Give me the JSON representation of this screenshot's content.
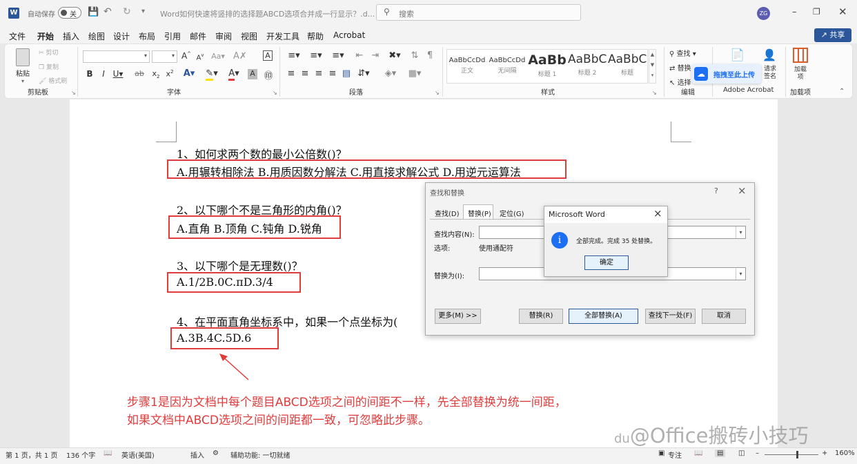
{
  "titlebar": {
    "autosave_label": "自动保存",
    "autosave_state": "关",
    "doc_title": "Word如何快速将竖排的选择题ABCD选项合并成一行显示？.d...",
    "search_placeholder": "搜索",
    "user_initials": "ZG",
    "share_label": "共享"
  },
  "menu": [
    "文件",
    "开始",
    "插入",
    "绘图",
    "设计",
    "布局",
    "引用",
    "邮件",
    "审阅",
    "视图",
    "开发工具",
    "帮助",
    "Acrobat"
  ],
  "ribbon": {
    "clipboard": {
      "paste": "粘贴",
      "cut": "剪切",
      "copy": "复制",
      "format_painter": "格式刷",
      "group": "剪贴板"
    },
    "font_group": "字体",
    "paragraph_group": "段落",
    "styles": [
      {
        "preview": "AaBbCcDd",
        "name": "正文"
      },
      {
        "preview": "AaBbCcDd",
        "name": "无间隔"
      },
      {
        "preview": "AaBb",
        "name": "标题 1"
      },
      {
        "preview": "AaBbC",
        "name": "标题 2"
      },
      {
        "preview": "AaBbC",
        "name": "标题"
      }
    ],
    "styles_group": "样式",
    "find": "查找",
    "replace": "替换",
    "select": "选择",
    "editing_group": "编辑",
    "upload_label": "拖拽至此上传",
    "request_sign": "请求签名",
    "acrobat_group": "Adobe Acrobat",
    "addins": "加载项",
    "addins_btn": "加载项"
  },
  "document": {
    "q1": "1、如何求两个数的最小公倍数()？",
    "a1": "A.用辗转相除法 B.用质因数分解法 C.用直接求解公式 D.用逆元运算法",
    "q2": "2、以下哪个不是三角形的内角()？",
    "a2": "A.直角 B.顶角 C.钝角 D.锐角",
    "q3": "3、以下哪个是无理数()？",
    "a3": "A.1/2B.0C.πD.3/4",
    "q4": "4、在平面直角坐标系中，如果一个点坐标为(",
    "a4": "A.3B.4C.5D.6",
    "note_line1": "步骤1是因为文档中每个题目ABCD选项之间的间距不一样，先全部替换为统一间距，",
    "note_line2": "如果文档中ABCD选项之间的间距都一致，可忽略此步骤。",
    "watermark": "@Office搬砖小技巧"
  },
  "find_replace": {
    "title": "查找和替换",
    "help": "?",
    "close": "×",
    "tabs": [
      "查找(D)",
      "替换(P)",
      "定位(G)"
    ],
    "find_label": "查找内容(N):",
    "options_label": "选项:",
    "options_value": "使用通配符",
    "replace_label": "替换为(I):",
    "more": "更多(M) >>",
    "replace_btn": "替换(R)",
    "replace_all": "全部替换(A)",
    "find_next": "查找下一处(F)",
    "cancel": "取消"
  },
  "msgbox": {
    "title": "Microsoft Word",
    "close": "×",
    "icon": "i",
    "message": "全部完成。完成 35 处替换。",
    "ok": "确定"
  },
  "status": {
    "page": "第 1 页，共 1 页",
    "words": "136 个字",
    "lang": "英语(美国)",
    "insert": "插入",
    "accessibility": "辅助功能: 一切就绪",
    "focus": "专注",
    "zoom": "160%"
  },
  "colors": {
    "accent": "#2b579a",
    "red": "#e03c3c"
  }
}
